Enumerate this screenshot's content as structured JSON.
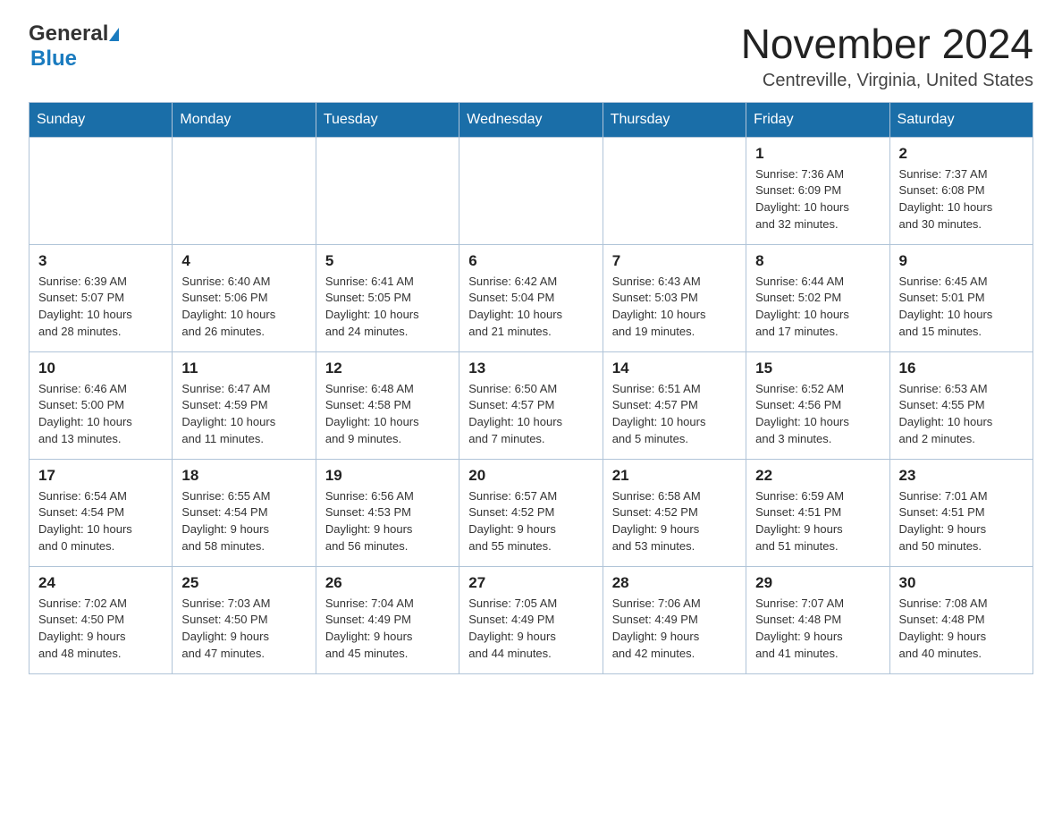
{
  "header": {
    "logo_general": "General",
    "logo_blue": "Blue",
    "title": "November 2024",
    "location": "Centreville, Virginia, United States"
  },
  "days_of_week": [
    "Sunday",
    "Monday",
    "Tuesday",
    "Wednesday",
    "Thursday",
    "Friday",
    "Saturday"
  ],
  "weeks": [
    [
      {
        "day": "",
        "info": ""
      },
      {
        "day": "",
        "info": ""
      },
      {
        "day": "",
        "info": ""
      },
      {
        "day": "",
        "info": ""
      },
      {
        "day": "",
        "info": ""
      },
      {
        "day": "1",
        "info": "Sunrise: 7:36 AM\nSunset: 6:09 PM\nDaylight: 10 hours\nand 32 minutes."
      },
      {
        "day": "2",
        "info": "Sunrise: 7:37 AM\nSunset: 6:08 PM\nDaylight: 10 hours\nand 30 minutes."
      }
    ],
    [
      {
        "day": "3",
        "info": "Sunrise: 6:39 AM\nSunset: 5:07 PM\nDaylight: 10 hours\nand 28 minutes."
      },
      {
        "day": "4",
        "info": "Sunrise: 6:40 AM\nSunset: 5:06 PM\nDaylight: 10 hours\nand 26 minutes."
      },
      {
        "day": "5",
        "info": "Sunrise: 6:41 AM\nSunset: 5:05 PM\nDaylight: 10 hours\nand 24 minutes."
      },
      {
        "day": "6",
        "info": "Sunrise: 6:42 AM\nSunset: 5:04 PM\nDaylight: 10 hours\nand 21 minutes."
      },
      {
        "day": "7",
        "info": "Sunrise: 6:43 AM\nSunset: 5:03 PM\nDaylight: 10 hours\nand 19 minutes."
      },
      {
        "day": "8",
        "info": "Sunrise: 6:44 AM\nSunset: 5:02 PM\nDaylight: 10 hours\nand 17 minutes."
      },
      {
        "day": "9",
        "info": "Sunrise: 6:45 AM\nSunset: 5:01 PM\nDaylight: 10 hours\nand 15 minutes."
      }
    ],
    [
      {
        "day": "10",
        "info": "Sunrise: 6:46 AM\nSunset: 5:00 PM\nDaylight: 10 hours\nand 13 minutes."
      },
      {
        "day": "11",
        "info": "Sunrise: 6:47 AM\nSunset: 4:59 PM\nDaylight: 10 hours\nand 11 minutes."
      },
      {
        "day": "12",
        "info": "Sunrise: 6:48 AM\nSunset: 4:58 PM\nDaylight: 10 hours\nand 9 minutes."
      },
      {
        "day": "13",
        "info": "Sunrise: 6:50 AM\nSunset: 4:57 PM\nDaylight: 10 hours\nand 7 minutes."
      },
      {
        "day": "14",
        "info": "Sunrise: 6:51 AM\nSunset: 4:57 PM\nDaylight: 10 hours\nand 5 minutes."
      },
      {
        "day": "15",
        "info": "Sunrise: 6:52 AM\nSunset: 4:56 PM\nDaylight: 10 hours\nand 3 minutes."
      },
      {
        "day": "16",
        "info": "Sunrise: 6:53 AM\nSunset: 4:55 PM\nDaylight: 10 hours\nand 2 minutes."
      }
    ],
    [
      {
        "day": "17",
        "info": "Sunrise: 6:54 AM\nSunset: 4:54 PM\nDaylight: 10 hours\nand 0 minutes."
      },
      {
        "day": "18",
        "info": "Sunrise: 6:55 AM\nSunset: 4:54 PM\nDaylight: 9 hours\nand 58 minutes."
      },
      {
        "day": "19",
        "info": "Sunrise: 6:56 AM\nSunset: 4:53 PM\nDaylight: 9 hours\nand 56 minutes."
      },
      {
        "day": "20",
        "info": "Sunrise: 6:57 AM\nSunset: 4:52 PM\nDaylight: 9 hours\nand 55 minutes."
      },
      {
        "day": "21",
        "info": "Sunrise: 6:58 AM\nSunset: 4:52 PM\nDaylight: 9 hours\nand 53 minutes."
      },
      {
        "day": "22",
        "info": "Sunrise: 6:59 AM\nSunset: 4:51 PM\nDaylight: 9 hours\nand 51 minutes."
      },
      {
        "day": "23",
        "info": "Sunrise: 7:01 AM\nSunset: 4:51 PM\nDaylight: 9 hours\nand 50 minutes."
      }
    ],
    [
      {
        "day": "24",
        "info": "Sunrise: 7:02 AM\nSunset: 4:50 PM\nDaylight: 9 hours\nand 48 minutes."
      },
      {
        "day": "25",
        "info": "Sunrise: 7:03 AM\nSunset: 4:50 PM\nDaylight: 9 hours\nand 47 minutes."
      },
      {
        "day": "26",
        "info": "Sunrise: 7:04 AM\nSunset: 4:49 PM\nDaylight: 9 hours\nand 45 minutes."
      },
      {
        "day": "27",
        "info": "Sunrise: 7:05 AM\nSunset: 4:49 PM\nDaylight: 9 hours\nand 44 minutes."
      },
      {
        "day": "28",
        "info": "Sunrise: 7:06 AM\nSunset: 4:49 PM\nDaylight: 9 hours\nand 42 minutes."
      },
      {
        "day": "29",
        "info": "Sunrise: 7:07 AM\nSunset: 4:48 PM\nDaylight: 9 hours\nand 41 minutes."
      },
      {
        "day": "30",
        "info": "Sunrise: 7:08 AM\nSunset: 4:48 PM\nDaylight: 9 hours\nand 40 minutes."
      }
    ]
  ]
}
